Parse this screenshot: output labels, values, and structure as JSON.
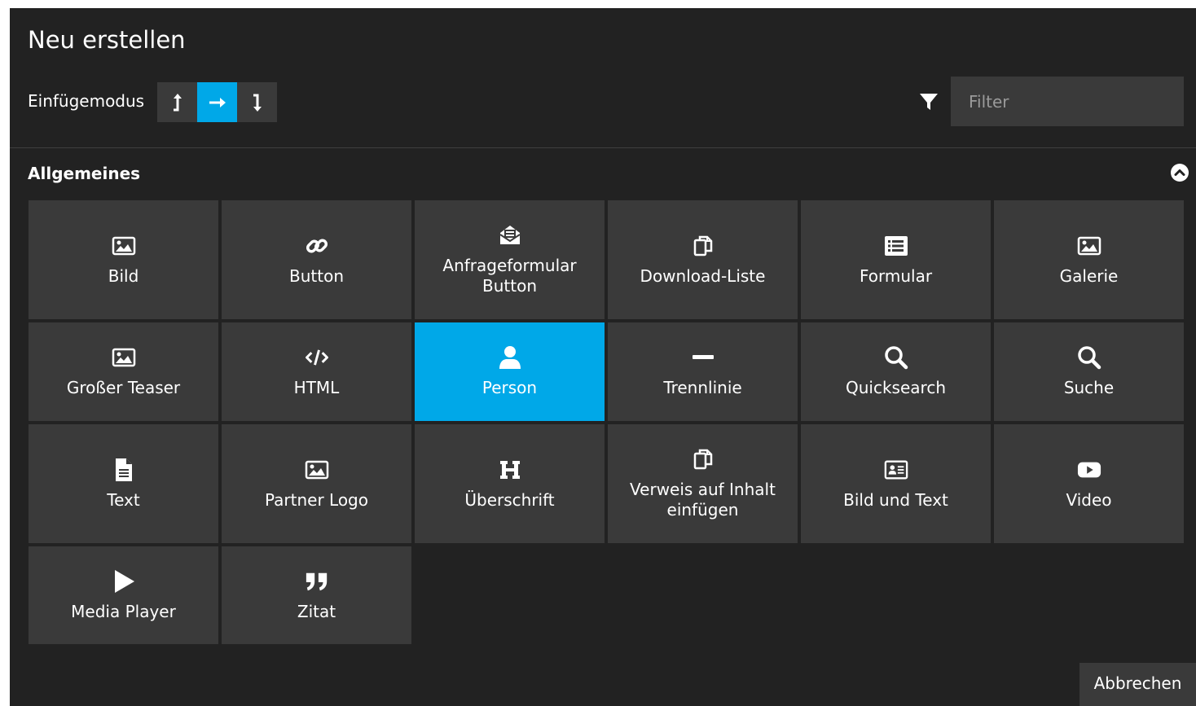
{
  "dialog": {
    "title": "Neu erstellen",
    "insert_mode_label": "Einfügemodus",
    "insert_modes": [
      {
        "icon": "arrow-up-icon",
        "active": false
      },
      {
        "icon": "arrow-right-icon",
        "active": true
      },
      {
        "icon": "arrow-down-icon",
        "active": false
      }
    ],
    "filter_placeholder": "Filter",
    "filter_value": "",
    "cancel_label": "Abbrechen"
  },
  "section": {
    "title": "Allgemeines",
    "tiles": [
      {
        "label": "Bild",
        "icon": "image-icon"
      },
      {
        "label": "Button",
        "icon": "link-icon"
      },
      {
        "label": "Anfrageformular\nButton",
        "icon": "envelope-open-icon"
      },
      {
        "label": "Download-Liste",
        "icon": "copy-icon"
      },
      {
        "label": "Formular",
        "icon": "list-alt-icon"
      },
      {
        "label": "Galerie",
        "icon": "image-icon"
      },
      {
        "label": "Großer Teaser",
        "icon": "image-icon"
      },
      {
        "label": "HTML",
        "icon": "code-icon"
      },
      {
        "label": "Person",
        "icon": "user-icon",
        "active": true
      },
      {
        "label": "Trennlinie",
        "icon": "minus-icon"
      },
      {
        "label": "Quicksearch",
        "icon": "search-icon"
      },
      {
        "label": "Suche",
        "icon": "search-icon"
      },
      {
        "label": "Text",
        "icon": "file-text-icon"
      },
      {
        "label": "Partner Logo",
        "icon": "image-icon"
      },
      {
        "label": "Überschrift",
        "icon": "heading-icon"
      },
      {
        "label": "Verweis auf Inhalt\neinfügen",
        "icon": "copy-icon"
      },
      {
        "label": "Bild und Text",
        "icon": "id-card-icon"
      },
      {
        "label": "Video",
        "icon": "youtube-icon"
      },
      {
        "label": "Media Player",
        "icon": "play-icon"
      },
      {
        "label": "Zitat",
        "icon": "quote-icon"
      }
    ]
  },
  "colors": {
    "background": "#222222",
    "tile": "#3a3a3a",
    "accent": "#00a8e8"
  }
}
